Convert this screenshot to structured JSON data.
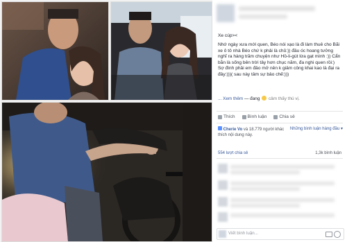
{
  "post": {
    "text_1": "Xe cúp><",
    "text_2": "Nhớ ngày xưa mới quen, Béo nói xạo là đi làm thuê cho Bãi xe ô tô nhà Béo chứ k phải là chủ:)) đầu óc hoang tưởng nghĩ ra hàng trăm chuyện như Hồ-li-gút lừa gạt mình :)) Cẩn bằn là sống bên trời tây hơn chục năm, đa nghi quen rồi:)",
    "text_3": "Sợ đình phải em đảo mở nên k giảm công khai kao là đại ra đây:)))( sau này tâm sự bảo chế:)))",
    "see_more": "... Xem thêm",
    "feeling_prefix": "— đang",
    "feeling": "cảm thấy thú vị."
  },
  "actions": {
    "like": "Thích",
    "comment": "Bình luận",
    "share": "Chia sẻ"
  },
  "reactions": {
    "name": "Cherie Vo",
    "and_others": "và 18.779 người khác thích nội dung này.",
    "sort_label": "Những bình luận hàng đầu ▾"
  },
  "stats": {
    "shares": "554 lượt chia sẻ",
    "comments": "1,3k bình luận"
  },
  "composer": {
    "placeholder": "Viết bình luận..."
  },
  "colors": {
    "link": "#365899",
    "text": "#1d2129",
    "muted": "#90949c"
  }
}
